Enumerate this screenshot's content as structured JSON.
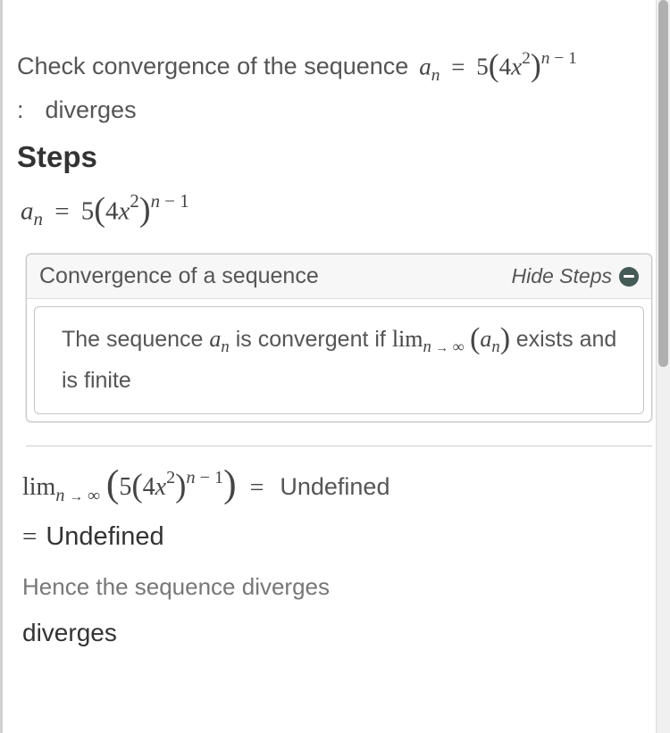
{
  "problem": {
    "prefix": "Check convergence of the sequence",
    "colon": ":",
    "answer": "diverges"
  },
  "steps_heading": "Steps",
  "rule": {
    "title": "Convergence of a sequence",
    "hide_label": "Hide Steps",
    "body_prefix": "The sequence",
    "body_mid": "is convergent if",
    "body_suffix": "exists and is finite"
  },
  "undefined_label": "Undefined",
  "hence": "Hence the sequence diverges",
  "final": "diverges",
  "math": {
    "a": "a",
    "n": "n",
    "eq": "=",
    "five": "5",
    "four": "4",
    "x": "x",
    "two": "2",
    "minus": "−",
    "one": "1",
    "lim": "lim",
    "arrow": "→",
    "inf": "∞",
    "lparen": "(",
    "rparen": ")"
  }
}
